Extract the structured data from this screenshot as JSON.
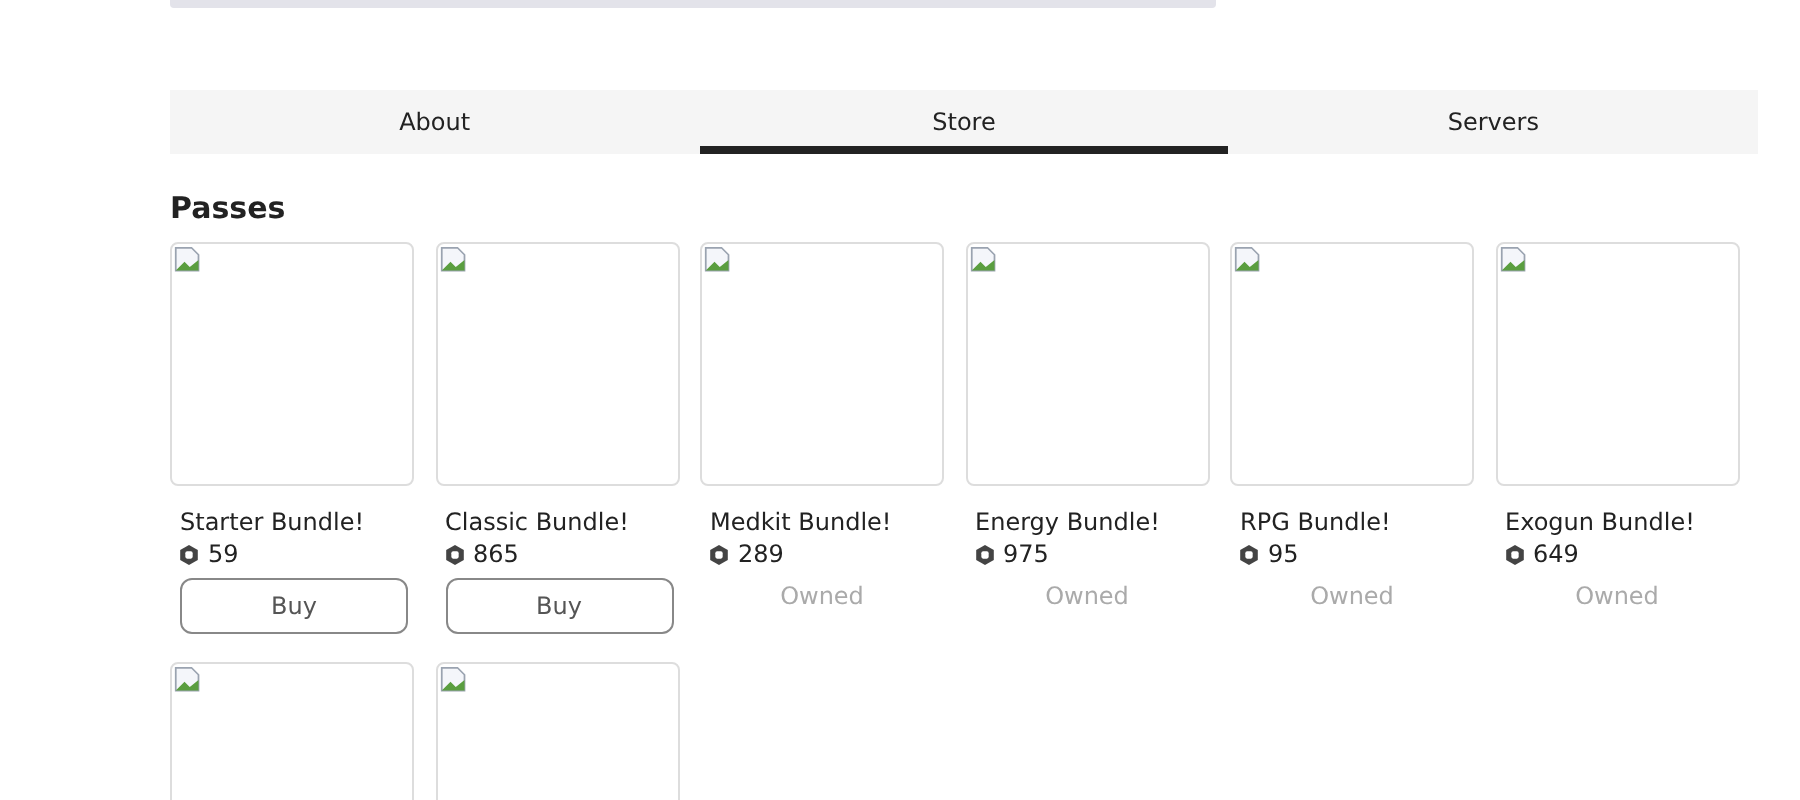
{
  "tabs": [
    {
      "label": "About",
      "selected": false
    },
    {
      "label": "Store",
      "selected": true
    },
    {
      "label": "Servers",
      "selected": false
    }
  ],
  "section_title": "Passes",
  "passes": [
    {
      "name": "Starter Bundle!",
      "price": "59",
      "owned": false,
      "action": "Buy"
    },
    {
      "name": "Classic Bundle!",
      "price": "865",
      "owned": false,
      "action": "Buy"
    },
    {
      "name": "Medkit Bundle!",
      "price": "289",
      "owned": true,
      "action": "Owned"
    },
    {
      "name": "Energy Bundle!",
      "price": "975",
      "owned": true,
      "action": "Owned"
    },
    {
      "name": "RPG Bundle!",
      "price": "95",
      "owned": true,
      "action": "Owned"
    },
    {
      "name": "Exogun Bundle!",
      "price": "649",
      "owned": true,
      "action": "Owned"
    }
  ]
}
